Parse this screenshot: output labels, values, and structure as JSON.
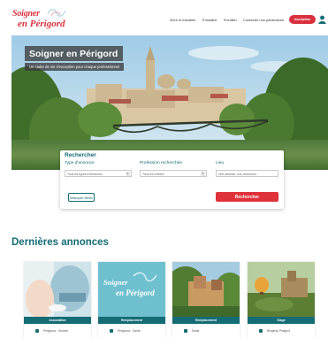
{
  "brand": {
    "line1": "Soigner",
    "line2": "en Périgord",
    "primary_color": "#d9303e",
    "teal_color": "#146c74"
  },
  "nav": {
    "items": [
      {
        "label": "Vivre et travailler"
      },
      {
        "label": "S'installer"
      },
      {
        "label": "S'outiller"
      },
      {
        "label": "Contacter nos partenaires"
      }
    ],
    "cta_label": "Inscription",
    "user_icon": "user-icon"
  },
  "hero": {
    "title": "Soigner en Périgord",
    "subtitle": "Un cadre de vie d'exception pour chaque professionnel"
  },
  "search": {
    "title": "Rechercher",
    "fields": [
      {
        "label": "Type d'annonce",
        "value": "Tous les types d'annonces"
      },
      {
        "label": "Profession recherchée",
        "value": "Tous les métiers"
      },
      {
        "label": "Lieu",
        "placeholder": "Une adresse, une commune..."
      }
    ],
    "reset_label": "Masquer filtres",
    "submit_label": "Rechercher"
  },
  "announcements": {
    "title": "Dernières annonces",
    "cards": [
      {
        "category": "Association",
        "location": "Périgueux - Secteur",
        "image": "medical-photo"
      },
      {
        "category": "Remplacement",
        "location": "Périgueux - Sarlat",
        "image": "brand-logo"
      },
      {
        "category": "Remplacement",
        "location": "Sarlat",
        "image": "village-photo"
      },
      {
        "category": "Stage",
        "location": "Bergerac Périgord",
        "image": "balloon-photo"
      }
    ],
    "card2_logo_line1": "Soigner",
    "card2_logo_line2": "en Périgord"
  }
}
